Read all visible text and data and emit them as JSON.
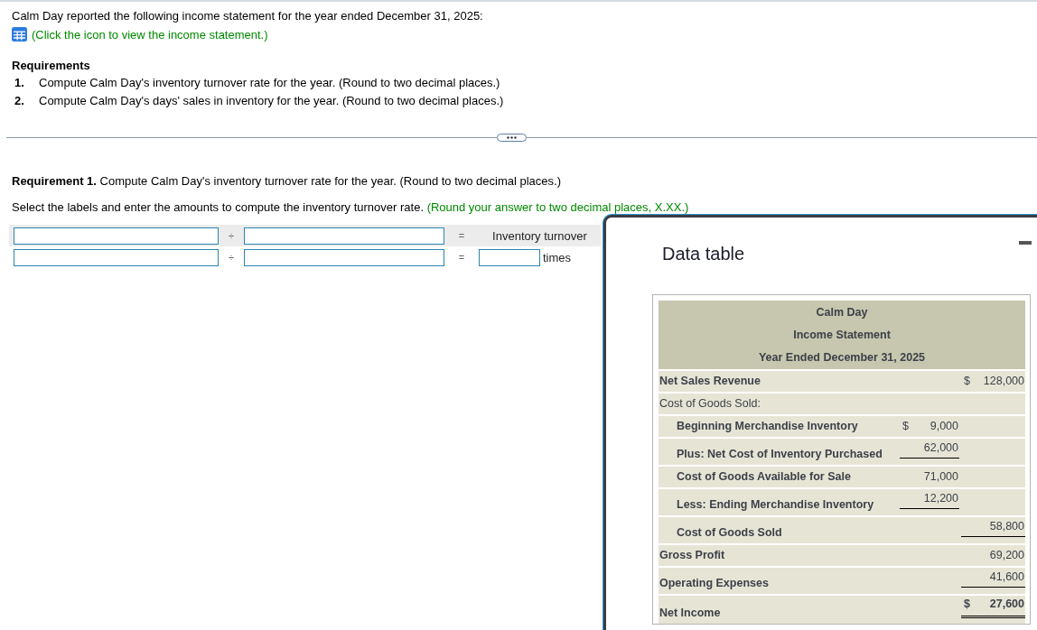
{
  "problem": {
    "intro": "Calm Day reported the following income statement for the year ended December 31, 2025:",
    "link": "(Click the icon to view the income statement.)"
  },
  "requirements": {
    "title": "Requirements",
    "items": [
      {
        "number": "1.",
        "text": "Compute Calm Day's inventory turnover rate for the year. (Round to two decimal places.)"
      },
      {
        "number": "2.",
        "text": "Compute Calm Day's days' sales in inventory for the year. (Round to two decimal places.)"
      }
    ]
  },
  "requirement_1": {
    "heading": "**Requirement 1.** Compute Calm Day's inventory turnover rate for the year. (Round to two decimal places.)",
    "instruction": "Select the labels and enter the amounts to compute the inventory turnover rate.",
    "hint": "(Round your answer to two decimal places, X.XX.)"
  },
  "formula": {
    "rows": [
      {
        "kind": "header",
        "divide": "÷",
        "equals": "=",
        "result": "Inventory turnover"
      },
      {
        "kind": "answer",
        "divide": "÷",
        "equals": "=",
        "unit": "times"
      }
    ]
  },
  "data_table": {
    "title": "Data table",
    "statement": {
      "company": "Calm Day",
      "title": "Income Statement",
      "period": "Year Ended December 31, 2025"
    },
    "rows": [
      {
        "label": "Net Sales Revenue",
        "bold": true,
        "amount_2": {
          "symbol": "$",
          "value": "128,000"
        }
      },
      {
        "label": "Cost of Goods Sold:",
        "bold": false,
        "children": [
          {
            "label": "Beginning Merchandise Inventory",
            "bold": true,
            "amount_1": {
              "symbol": "$",
              "value": "9,000"
            }
          },
          {
            "label": "Plus: Net Cost of Inventory Purchased",
            "bold": true,
            "amount_1": {
              "value": "62,000",
              "underlined": true
            }
          },
          {
            "label": "Cost of Goods Available for Sale",
            "bold": true,
            "amount_1": {
              "value": "71,000"
            }
          },
          {
            "label": "Less: Ending Merchandise Inventory",
            "bold": true,
            "amount_1": {
              "value": "12,200",
              "underlined": true
            }
          },
          {
            "label": "Cost of Goods Sold",
            "bold": true,
            "amount_2": {
              "value": "58,800",
              "underlined": true
            }
          }
        ]
      },
      {
        "label": "Gross Profit",
        "bold": true,
        "amount_2": {
          "value": "69,200"
        }
      },
      {
        "label": "Operating Expenses",
        "bold": true,
        "amount_2": {
          "value": "41,600",
          "underlined": true
        }
      },
      {
        "label": "Net Income",
        "bold": true,
        "amount_2": {
          "symbol": "$",
          "value": "27,600",
          "double_underlined": true,
          "bold": true
        }
      }
    ]
  }
}
